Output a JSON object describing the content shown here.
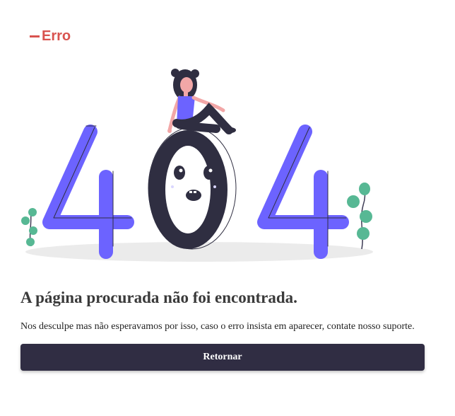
{
  "header": {
    "error_label": "Erro"
  },
  "illustration": {
    "icon": "404-illustration",
    "digits": [
      "4",
      "0",
      "4"
    ]
  },
  "main": {
    "title": "A página procurada não foi encontrada.",
    "message": "Nos desculpe mas não esperavamos por isso, caso o erro insista em aparecer, contate nosso suporte.",
    "return_label": "Retornar"
  },
  "colors": {
    "error_red": "#d9534f",
    "accent_purple": "#6c63ff",
    "dark": "#2f2e41",
    "leaf_green": "#57b894",
    "button_bg": "#302d43"
  }
}
